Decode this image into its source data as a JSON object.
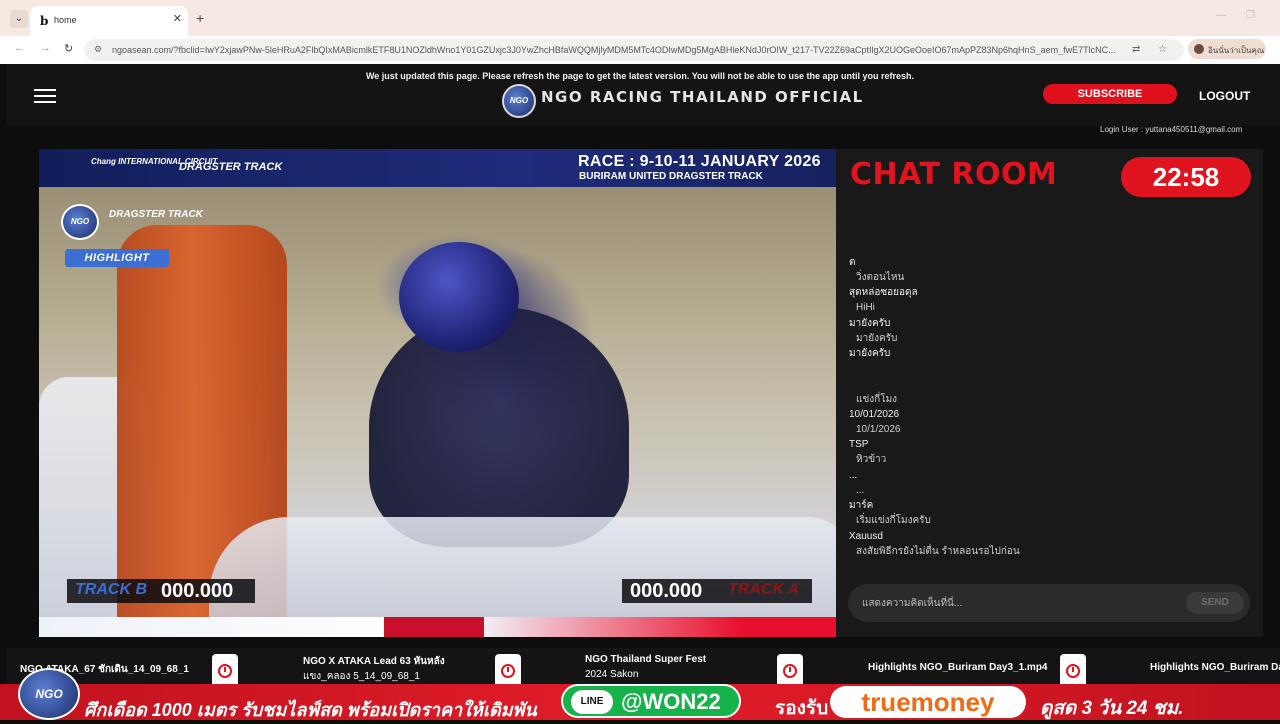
{
  "browser": {
    "tab_title": "home",
    "tab_favicon": "b",
    "url": "ngoasean.com/?fbclid=IwY2xjawPNw-5leHRuA2FlbQIxMABicmlkETF8U1NOZldhWno1Y01GZUxjc3J0YwZhcHBfaWQQMjlyMDM5MTc4ODIwMDg5MgABHleKNdJ0rOIW_t217-TV22Z69aCptIlgX2UOGeOoeIO67mApPZ83Np6hqHnS_aem_fwE7TlcNC...",
    "profile_label": "อินนั่นว่าเป็นคุณ",
    "icons": [
      "tab-menu-icon",
      "close-icon",
      "new-tab-icon",
      "back-icon",
      "forward-icon",
      "reload-icon",
      "site-info-icon",
      "translate-icon",
      "bookmark-star-icon"
    ]
  },
  "header": {
    "notice": "We just updated this page. Please refresh the page to get the latest version. You will not be able to use the app until you refresh.",
    "logo_text": "NGO",
    "site_title": "NGO RACING THAILAND OFFICIAL",
    "subscribe_label": "SUBSCRIBE",
    "logout_label": "LOGOUT",
    "login_user": "Login User : yuttana450511@gmail.com"
  },
  "video": {
    "sponsor_chang": "Chang INTERNATIONAL CIRCUIT",
    "sponsor_dragster": "DRAGSTER TRACK",
    "race_title": "RACE : 9-10-11 JANUARY 2026",
    "race_subtitle": "BURIRAM UNITED DRAGSTER TRACK",
    "highlight_tag": "HIGHLIGHT",
    "logo_text": "NGO",
    "track_b_label": "TRACK B",
    "track_b_time": "000.000",
    "track_a_label": "TRACK A",
    "track_a_time": "000.000"
  },
  "chat": {
    "title": "CHAT ROOM",
    "timer": "22:58",
    "messages": [
      {
        "user": "ต",
        "text": "วิ่งตอนไหน"
      },
      {
        "user": "สุดหล่อซอยอดุล",
        "text": "HiHi"
      },
      {
        "user": "มายังครับ",
        "text": "มายังครับ"
      },
      {
        "user": "มายังครับ",
        "text": ""
      },
      {
        "user": "",
        "text": "แข่งกี่โมง"
      },
      {
        "user": "10/01/2026",
        "text": "10/1/2026"
      },
      {
        "user": "TSP",
        "text": "หิวข้าว"
      },
      {
        "user": "...",
        "text": "..."
      },
      {
        "user": "มาร์ค",
        "text": "เริ่มแข่งกี่โมงครับ"
      },
      {
        "user": "Xauusd",
        "text": "สงสัยพิธีกรยังไม่ตื่น รำหลอนรอไปก่อน"
      }
    ],
    "input_placeholder": "แสดงความคิดเห็นที่นี่...",
    "send_label": "SEND"
  },
  "strip": {
    "items": [
      {
        "title": "NGO ATAKA_67 ชักเดิน_14_09_68_1",
        "subtitle": ""
      },
      {
        "title": "NGO X ATAKA Lead 63 หันหลัง",
        "subtitle": "แขง_คลอง 5_14_09_68_1"
      },
      {
        "title": "NGO Thailand Super Fest",
        "subtitle": "2024 Sakon"
      },
      {
        "title": "Highlights NGO_Buriram Day3_1.mp4",
        "subtitle": ""
      },
      {
        "title": "Highlights NGO_Buriram Da",
        "subtitle": ""
      }
    ]
  },
  "banner": {
    "logo_text": "NGO",
    "text1": "ศึกเดือด 1000 เมตร รับชมไลฟ์สด พร้อมเปิดราคาให้เดิมพัน",
    "line_badge": "LINE",
    "line_id": "@WON22",
    "text2": "รองรับ",
    "truemoney": "truemoney",
    "text3": "ดูสด 3 วัน 24 ชม."
  },
  "colors": {
    "accent_red": "#e0141e",
    "line_green": "#16b34a",
    "truemoney_orange": "#ef6b16",
    "track_b_blue": "#3b6fd4"
  }
}
